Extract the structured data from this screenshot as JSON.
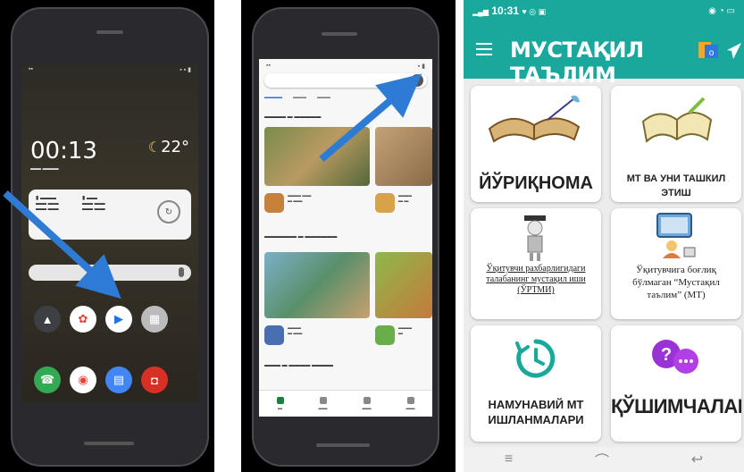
{
  "home_screen": {
    "clock": "00:13",
    "temperature": "22°",
    "apps_row1": [
      "drive-icon",
      "photos-icon",
      "play-store-icon",
      "folder-icon"
    ],
    "apps_row2": [
      "phone-icon",
      "chrome-icon",
      "messages-icon",
      "camera-icon"
    ]
  },
  "play_store": {
    "sections": [
      "apps-section",
      "games-section"
    ]
  },
  "app_screen": {
    "status_time": "10:31",
    "title": "МУСТАҚИЛ ТАЪЛИМ",
    "colors": {
      "accent": "#1aa79c",
      "purple": "#8a2be2",
      "teal": "#18a99b"
    },
    "cards": {
      "guide": "ЙЎРИҚНОМА",
      "mt_and_organization": "МТ ВА УНИ ТАШКИЛ ЭТИШ",
      "teacher_guided": "Ўқитувчи рахбарлигидаги талабанинг мустақил иши (ЎРТМИ)",
      "teacher_independent": "Ўқитувчига боғлиқ бўлмаган “Мустақил таълим” (МТ)",
      "sample_works": "НАМУНАВИЙ МТ ИШЛАНМАЛАРИ",
      "appendices": "ҚЎШИМЧАЛАР"
    }
  }
}
